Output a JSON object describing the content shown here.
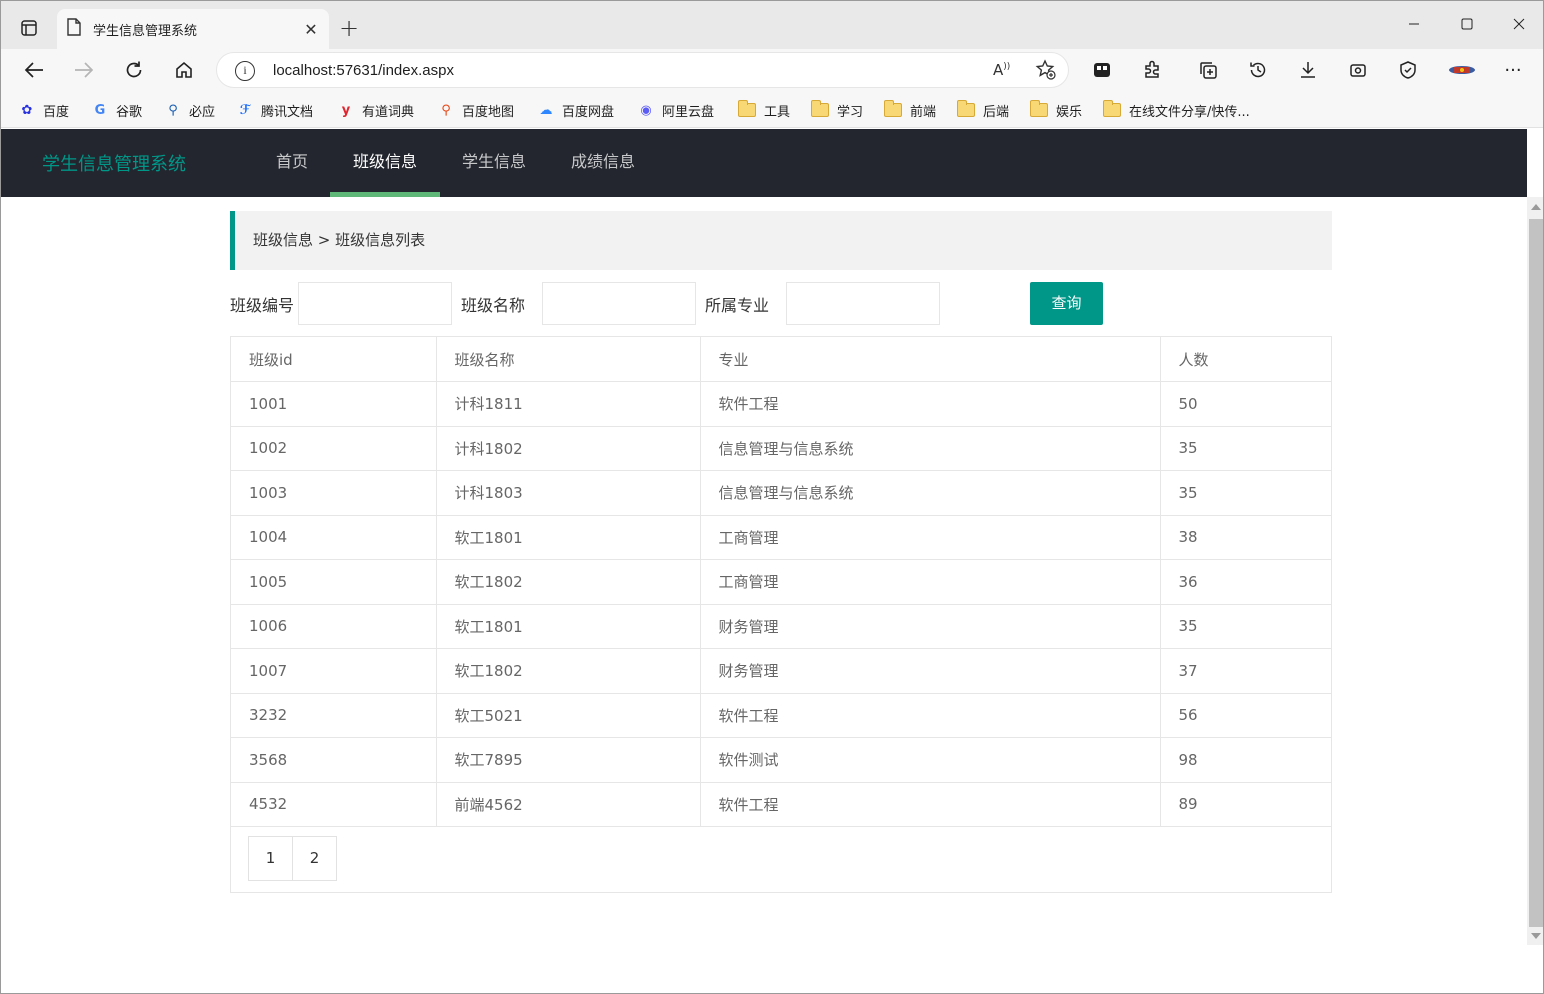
{
  "browser": {
    "tab_title": "学生信息管理系统",
    "url": "localhost:57631/index.aspx",
    "bookmarks": [
      "百度",
      "谷歌",
      "必应",
      "腾讯文档",
      "有道词典",
      "百度地图",
      "百度网盘",
      "阿里云盘",
      "工具",
      "学习",
      "前端",
      "后端",
      "娱乐",
      "在线文件分享/快传..."
    ]
  },
  "app": {
    "brand": "学生信息管理系统",
    "nav": [
      "首页",
      "班级信息",
      "学生信息",
      "成绩信息"
    ],
    "active_nav": "班级信息",
    "breadcrumb": "班级信息 > 班级信息列表",
    "accent_color": "#009688"
  },
  "filters": {
    "class_no_label": "班级编号",
    "class_name_label": "班级名称",
    "major_label": "所属专业",
    "query_button": "查询"
  },
  "table": {
    "headers": [
      "班级id",
      "班级名称",
      "专业",
      "人数"
    ],
    "rows": [
      [
        "1001",
        "计科1811",
        "软件工程",
        "50"
      ],
      [
        "1002",
        "计科1802",
        "信息管理与信息系统",
        "35"
      ],
      [
        "1003",
        "计科1803",
        "信息管理与信息系统",
        "35"
      ],
      [
        "1004",
        "软工1801",
        "工商管理",
        "38"
      ],
      [
        "1005",
        "软工1802",
        "工商管理",
        "36"
      ],
      [
        "1006",
        "软工1801",
        "财务管理",
        "35"
      ],
      [
        "1007",
        "软工1802",
        "财务管理",
        "37"
      ],
      [
        "3232",
        "软工5021",
        "软件工程",
        "56"
      ],
      [
        "3568",
        "软工7895",
        "软件测试",
        "98"
      ],
      [
        "4532",
        "前端4562",
        "软件工程",
        "89"
      ]
    ]
  },
  "pager": {
    "pages": [
      "1",
      "2"
    ]
  }
}
